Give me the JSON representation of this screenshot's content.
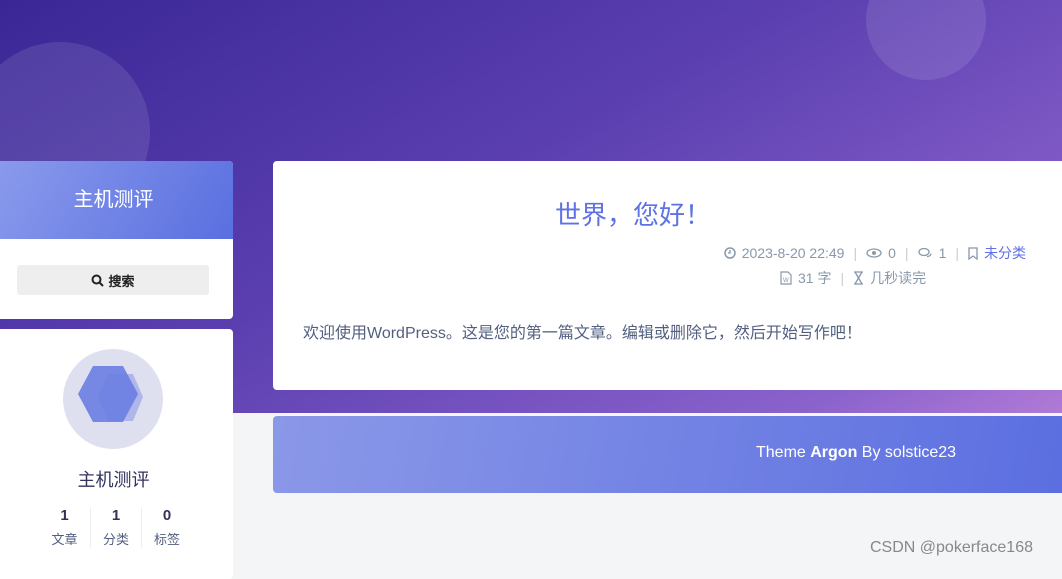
{
  "sidebar": {
    "site_title": "主机测评",
    "search_label": "搜索",
    "profile_name": "主机测评",
    "stats": [
      {
        "value": "1",
        "label": "文章"
      },
      {
        "value": "1",
        "label": "分类"
      },
      {
        "value": "0",
        "label": "标签"
      }
    ]
  },
  "post": {
    "title": "世界，您好！",
    "date": "2023-8-20 22:49",
    "views": "0",
    "comments": "1",
    "category": "未分类",
    "word_count": "31 字",
    "read_time": "几秒读完",
    "excerpt": "欢迎使用WordPress。这是您的第一篇文章。编辑或删除它，然后开始写作吧！"
  },
  "footer": {
    "prefix": "Theme ",
    "theme": "Argon",
    "suffix": " By solstice23"
  },
  "watermark": "CSDN @pokerface168"
}
